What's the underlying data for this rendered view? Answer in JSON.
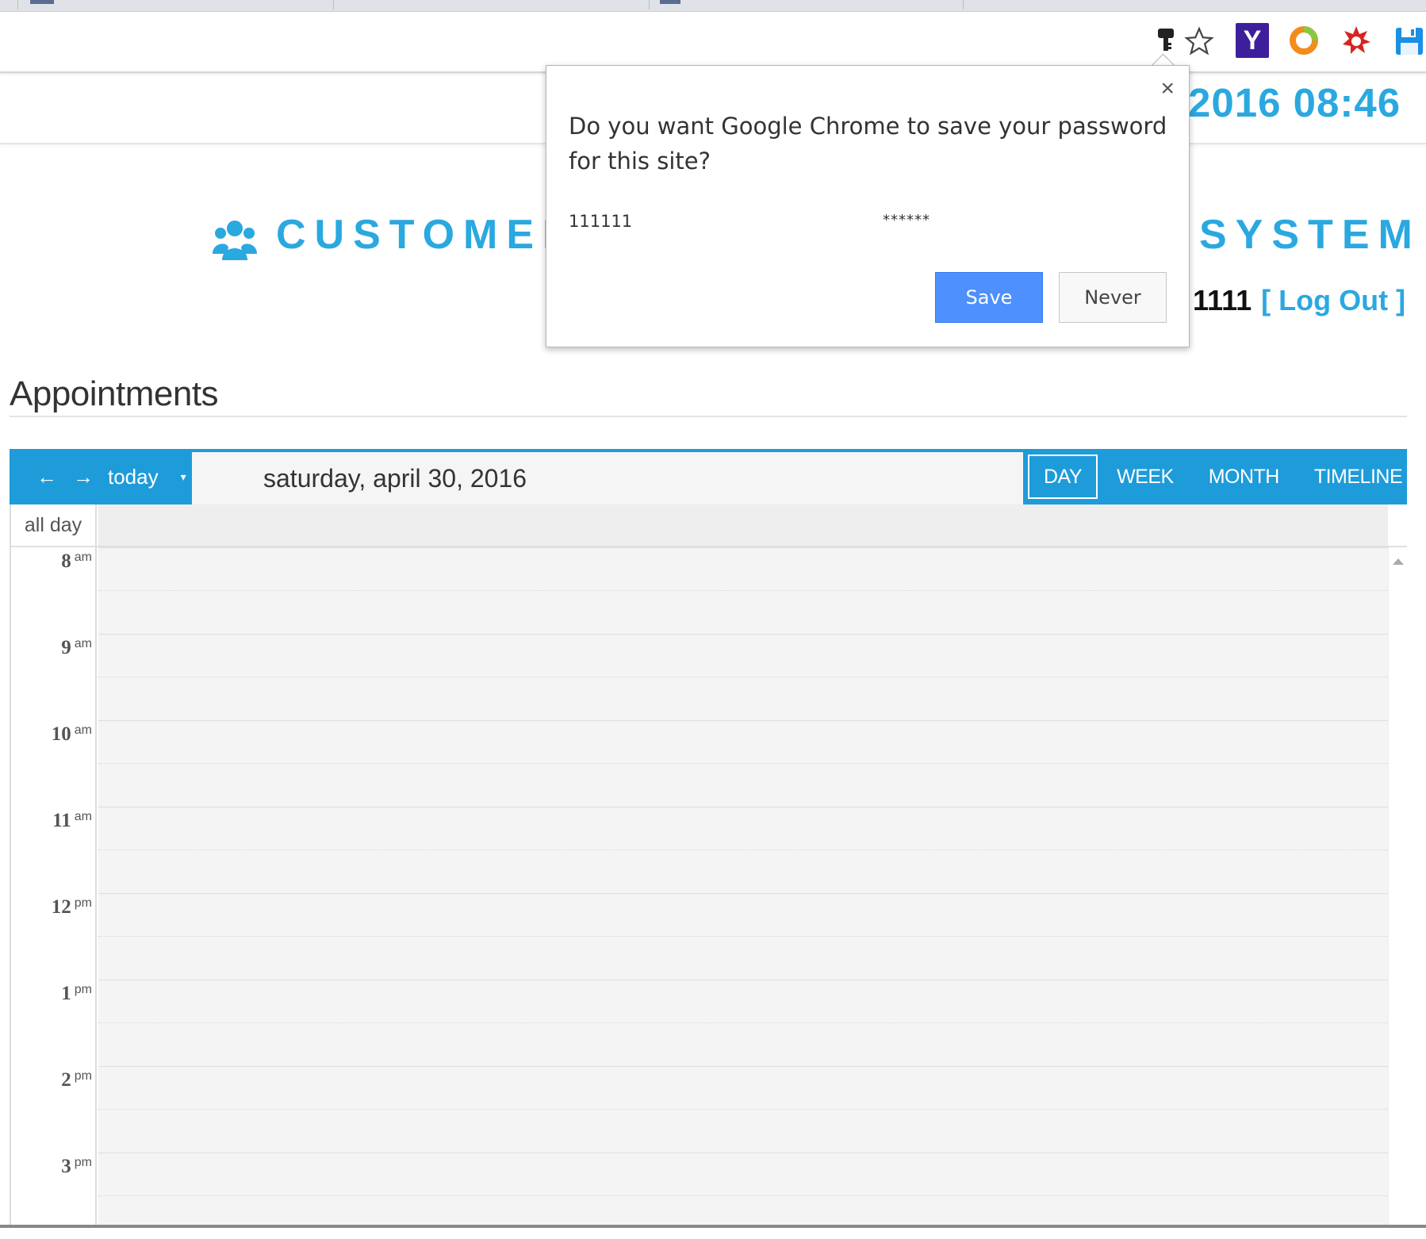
{
  "browser": {
    "icons": [
      "key-icon",
      "star-icon",
      "yahoo-extension-icon",
      "ring-extension-icon",
      "burst-extension-icon",
      "save-extension-icon"
    ],
    "yahoo_letter": "Y"
  },
  "header": {
    "clock_text": "2016 08:46",
    "brand_left": "CUSTOMER",
    "brand_right": "SYSTEM",
    "user_id": "1111",
    "logout_label": "[ Log Out ]",
    "accent_color": "#2aa8e0"
  },
  "main": {
    "section_title": "Appointments"
  },
  "calendar": {
    "nav": {
      "prev": "←",
      "next": "→",
      "today_label": "today",
      "caret": "▾"
    },
    "title": "saturday, april 30, 2016",
    "views": [
      "DAY",
      "WEEK",
      "MONTH",
      "TIMELINE"
    ],
    "active_view": "DAY",
    "all_day_label": "all day",
    "hours": [
      {
        "h": "8",
        "p": "am"
      },
      {
        "h": "9",
        "p": "am"
      },
      {
        "h": "10",
        "p": "am"
      },
      {
        "h": "11",
        "p": "am"
      },
      {
        "h": "12",
        "p": "pm"
      },
      {
        "h": "1",
        "p": "pm"
      },
      {
        "h": "2",
        "p": "pm"
      },
      {
        "h": "3",
        "p": "pm"
      }
    ],
    "toolbar_color": "#1e9bd9"
  },
  "password_dialog": {
    "close": "×",
    "question": "Do you want Google Chrome to save your password for this site?",
    "username": "111111",
    "password_masked": "******",
    "save_label": "Save",
    "never_label": "Never",
    "save_color": "#4d90fe"
  }
}
